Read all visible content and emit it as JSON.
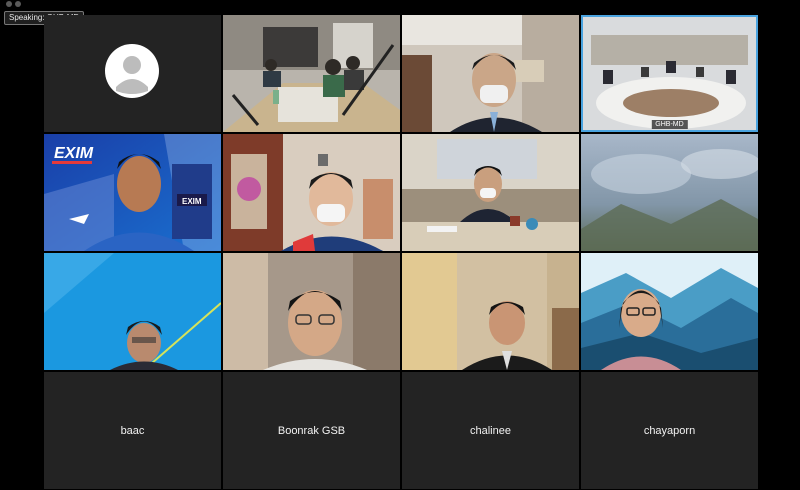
{
  "speaking_indicator": "Speaking: GHB-MD",
  "active_speaker_label": "GHB-MD",
  "participants_no_video": [
    "baac",
    "Boonrak GSB",
    "chalinee",
    "chayaporn"
  ],
  "colors": {
    "active_border": "#4aa3df",
    "tile_bg": "#232323",
    "page_bg": "#000000"
  },
  "video_logos": {
    "exim_banner": "EXIM",
    "exim_building": "EXIM"
  }
}
